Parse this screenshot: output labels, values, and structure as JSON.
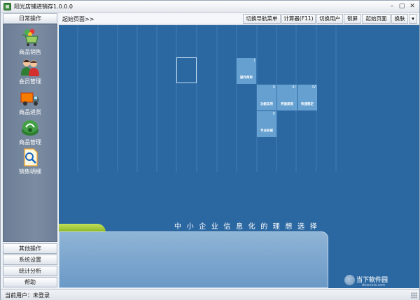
{
  "window": {
    "title": "阳光店铺进销存1.0.0.0",
    "controls": {
      "minimize": "–",
      "maximize": "▢",
      "close": "✕"
    }
  },
  "sidebar": {
    "header": "日常操作",
    "items": [
      {
        "label": "商品销售",
        "icon": "shopping-cart-icon"
      },
      {
        "label": "会员管理",
        "icon": "members-icon"
      },
      {
        "label": "商品进货",
        "icon": "delivery-truck-icon"
      },
      {
        "label": "商品管理",
        "icon": "goods-management-icon"
      },
      {
        "label": "销售明细",
        "icon": "sales-detail-icon"
      }
    ],
    "bottom_buttons": [
      "其他操作",
      "系统设置",
      "统计分析",
      "帮助"
    ]
  },
  "navbar": {
    "breadcrumb": "起始页面>>",
    "buttons": [
      "切换导航菜单",
      "计算器(F11)",
      "切换用户",
      "锁屏",
      "起始页面",
      "换肤"
    ],
    "skin_dropdown_arrow": "▾"
  },
  "main": {
    "tiles": [
      {
        "label": "操作简单",
        "roman": "I"
      },
      {
        "label": "功能实用",
        "roman": "II"
      },
      {
        "label": "界面美观",
        "roman": "III"
      },
      {
        "label": "快速稳定",
        "roman": "IV"
      },
      {
        "label": "专业权威",
        "roman": "V"
      }
    ],
    "slogan": "中小企业信息化的理想选择",
    "watermark": {
      "text": "当下软件园",
      "sub": "downxia.com"
    }
  },
  "status": {
    "current_user_label": "当前用户：",
    "current_user_value": "未登录"
  },
  "colors": {
    "main_bg": "#2b68a2",
    "sidebar_bg": "#7b8ca2",
    "tile": "#96cdf5",
    "green_tab": "#9bc43a"
  }
}
